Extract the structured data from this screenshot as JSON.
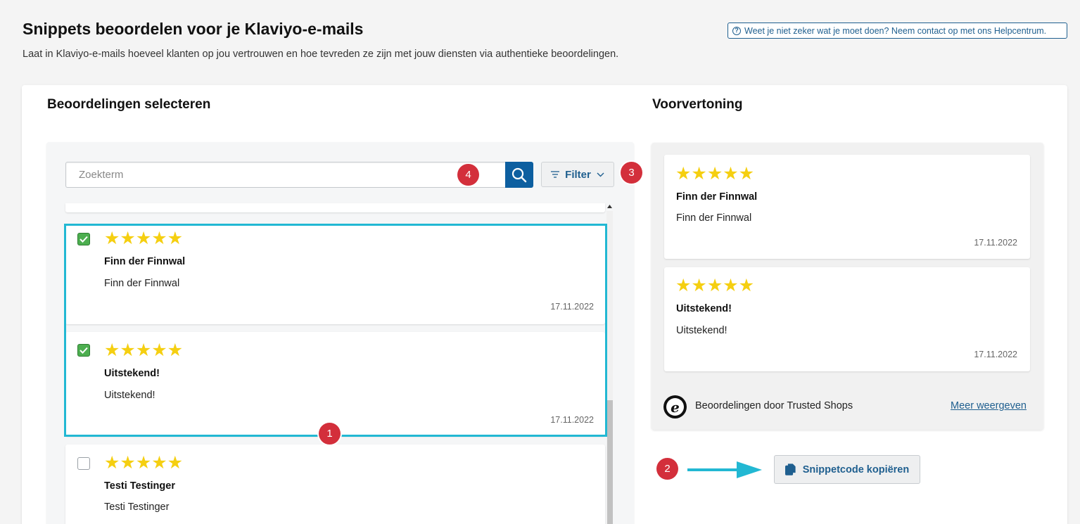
{
  "header": {
    "title": "Snippets beoordelen voor je Klaviyo-e-mails",
    "subtitle": "Laat in Klaviyo-e-mails hoeveel klanten op jou vertrouwen en hoe tevreden ze zijn met jouw diensten via authentieke beoordelingen.",
    "help_link": "Weet je niet zeker wat je moet doen? Neem contact op met ons Helpcentrum."
  },
  "select_section": {
    "title": "Beoordelingen selecteren",
    "search_placeholder": "Zoekterm",
    "filter_label": "Filter"
  },
  "reviews": [
    {
      "checked": true,
      "stars": 5,
      "title": "Finn der Finnwal",
      "text": "Finn der Finnwal",
      "date": "17.11.2022"
    },
    {
      "checked": true,
      "stars": 5,
      "title": "Uitstekend!",
      "text": "Uitstekend!",
      "date": "17.11.2022"
    },
    {
      "checked": false,
      "stars": 5,
      "title": "Testi Testinger",
      "text": "Testi Testinger",
      "date": ""
    }
  ],
  "preview_section": {
    "title": "Voorvertoning",
    "cards": [
      {
        "stars": 5,
        "title": "Finn der Finnwal",
        "text": "Finn der Finnwal",
        "date": "17.11.2022"
      },
      {
        "stars": 5,
        "title": "Uitstekend!",
        "text": "Uitstekend!",
        "date": "17.11.2022"
      }
    ],
    "footer_text": "Beoordelingen door Trusted Shops",
    "footer_link": "Meer weergeven"
  },
  "copy_button_label": "Snippetcode kopiëren",
  "annotations": {
    "badge_1": "1",
    "badge_2": "2",
    "badge_3": "3",
    "badge_4": "4"
  },
  "colors": {
    "accent": "#1f5f8f",
    "star": "#f5cf11",
    "selection": "#22b8d3",
    "badge": "#d32f3b",
    "checkbox": "#4cae4f"
  },
  "star_glyphs": "★★★★★"
}
